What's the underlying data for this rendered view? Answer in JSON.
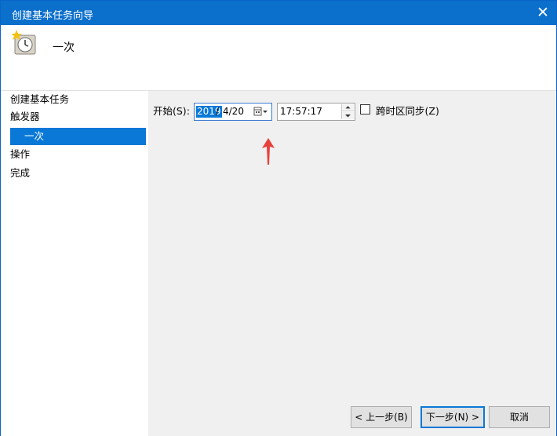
{
  "window": {
    "title": "创建基本任务向导",
    "close_glyph": "✕"
  },
  "header": {
    "icon": "clock-icon",
    "title": "一次"
  },
  "sidebar": {
    "items": [
      {
        "label": "创建基本任务",
        "level": 0,
        "selected": false
      },
      {
        "label": "触发器",
        "level": 0,
        "selected": false
      },
      {
        "label": "一次",
        "level": 1,
        "selected": true
      },
      {
        "label": "操作",
        "level": 0,
        "selected": false
      },
      {
        "label": "完成",
        "level": 0,
        "selected": false
      }
    ]
  },
  "trigger": {
    "start_label": "开始(S):",
    "date": {
      "year": "2019",
      "separator": "/",
      "month_day": "4/20"
    },
    "time": "17:57:17",
    "sync_timezones_label": "跨时区同步(Z)",
    "sync_timezones_checked": false
  },
  "buttons": {
    "back": "< 上一步(B)",
    "next": "下一步(N) >",
    "cancel": "取消"
  },
  "colors": {
    "titlebar": "#0b6fcc",
    "selection": "#0a78d7",
    "annotation_arrow": "#e8413c"
  }
}
